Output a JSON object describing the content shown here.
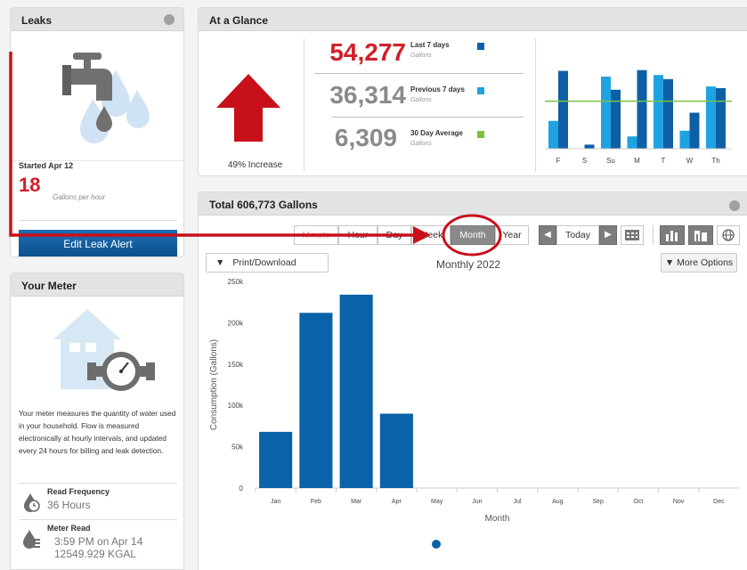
{
  "leaks": {
    "title": "Leaks",
    "started": "Started Apr 12",
    "value": "18",
    "unit": "Gallons per hour",
    "button": "Edit Leak Alert"
  },
  "meter": {
    "title": "Your Meter",
    "description": "Your meter measures the quantity of water used in your household. Flow is measured electronically at hourly intervals, and updated every 24 hours for billing and leak detection.",
    "read_frequency_label": "Read Frequency",
    "read_frequency_value": "36 Hours",
    "meter_read_label": "Meter Read",
    "meter_read_time": "3:59 PM on Apr 14",
    "meter_read_value": "12549.929 KGAL"
  },
  "glance": {
    "title": "At a Glance",
    "increase": "49% Increase",
    "last7_value": "54,277",
    "last7_label": "Last 7 days",
    "prev7_value": "36,314",
    "prev7_label": "Previous 7 days",
    "avg30_value": "6,309",
    "avg30_label": "30 Day Average",
    "unit": "Gallons",
    "colors": {
      "last7": "#0f5fa6",
      "prev7": "#1fa3e0",
      "avg30": "#7ac143",
      "increase_arrow": "#c8101a"
    },
    "mini_chart": {
      "days": [
        "F",
        "S",
        "Su",
        "M",
        "T",
        "W",
        "Th"
      ],
      "last7": [
        0.95,
        0.05,
        0.72,
        0.96,
        0.85,
        0.44,
        0.74
      ],
      "prev7": [
        0.34,
        0.0,
        0.88,
        0.15,
        0.9,
        0.22,
        0.76
      ],
      "average": 0.58
    }
  },
  "total": {
    "title": "Total 606,773 Gallons",
    "segments": [
      "Minute",
      "Hour",
      "Day",
      "Week",
      "Month",
      "Year"
    ],
    "active_segment": "Month",
    "today_label": "Today",
    "print_label": "Print/Download",
    "more_options_label": "More Options"
  },
  "chart_data": {
    "type": "bar",
    "title": "Monthly 2022",
    "xlabel": "Month",
    "ylabel": "Consumption (Gallons)",
    "categories": [
      "Jan",
      "Feb",
      "Mar",
      "Apr",
      "May",
      "Jun",
      "Jul",
      "Aug",
      "Sep",
      "Oct",
      "Nov",
      "Dec"
    ],
    "values": [
      68000,
      212000,
      234000,
      90000,
      0,
      0,
      0,
      0,
      0,
      0,
      0,
      0
    ],
    "ylim": [
      0,
      250000
    ],
    "yticks": [
      "0",
      "50k",
      "100k",
      "150k",
      "200k",
      "250k"
    ],
    "bar_color": "#0a62a8",
    "grid": false,
    "legend": "none"
  }
}
